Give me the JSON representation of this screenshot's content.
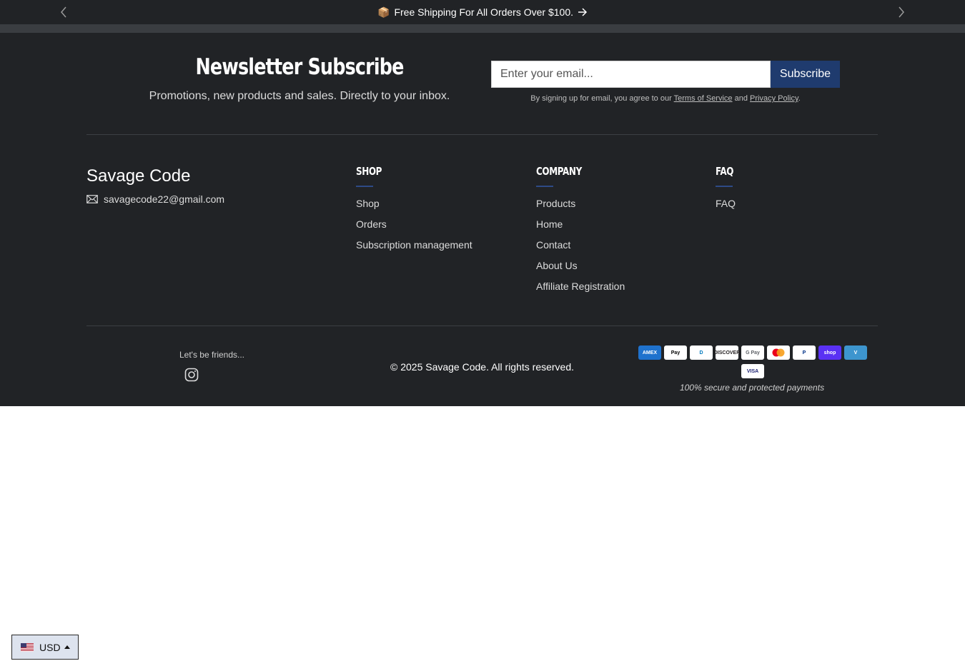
{
  "announcement": {
    "emoji": "📦",
    "text": "Free Shipping For All Orders Over $100."
  },
  "newsletter": {
    "title": "Newsletter Subscribe",
    "subtitle": "Promotions, new products and sales. Directly to your inbox.",
    "email_placeholder": "Enter your email...",
    "subscribe_label": "Subscribe",
    "legal_prefix": "By signing up for email, you agree to our",
    "terms_label": "Terms of Service",
    "legal_and": "and",
    "privacy_label": "Privacy Policy",
    "legal_suffix": "."
  },
  "brand": {
    "name": "Savage Code",
    "email": "savagecode22@gmail.com"
  },
  "columns": [
    {
      "title": "SHOP",
      "links": [
        "Shop",
        "Orders",
        "Subscription management"
      ]
    },
    {
      "title": "COMPANY",
      "links": [
        "Products",
        "Home",
        "Contact",
        "About Us",
        "Affiliate Registration"
      ]
    },
    {
      "title": "FAQ",
      "links": [
        "FAQ"
      ]
    }
  ],
  "social": {
    "label": "Let's be friends..."
  },
  "copyright": "© 2025 Savage Code. All rights reserved.",
  "payments": {
    "methods": [
      {
        "name": "amex-icon",
        "label": "AMEX",
        "bg": "#1f72cd",
        "fg": "#ffffff"
      },
      {
        "name": "apple-pay-icon",
        "label": "Pay",
        "bg": "#ffffff",
        "fg": "#000000"
      },
      {
        "name": "diners-club-icon",
        "label": "D",
        "bg": "#ffffff",
        "fg": "#0079be"
      },
      {
        "name": "discover-icon",
        "label": "DISCOVER",
        "bg": "#ffffff",
        "fg": "#231f20"
      },
      {
        "name": "google-pay-icon",
        "label": "G Pay",
        "bg": "#ffffff",
        "fg": "#5f6368"
      },
      {
        "name": "mastercard-icon",
        "label": "",
        "bg": "#ffffff",
        "fg": "#eb001b"
      },
      {
        "name": "paypal-icon",
        "label": "P",
        "bg": "#ffffff",
        "fg": "#003087"
      },
      {
        "name": "shop-pay-icon",
        "label": "shop",
        "bg": "#5a31f4",
        "fg": "#ffffff"
      },
      {
        "name": "venmo-icon",
        "label": "V",
        "bg": "#3d95ce",
        "fg": "#ffffff"
      },
      {
        "name": "visa-icon",
        "label": "VISA",
        "bg": "#ffffff",
        "fg": "#1a1f71"
      }
    ],
    "caption": "100% secure and protected payments"
  },
  "currency": {
    "code": "USD"
  },
  "colors": {
    "footer_bg": "#212326",
    "accent_button": "#1f3b6e",
    "column_underline": "#2e4a86"
  }
}
